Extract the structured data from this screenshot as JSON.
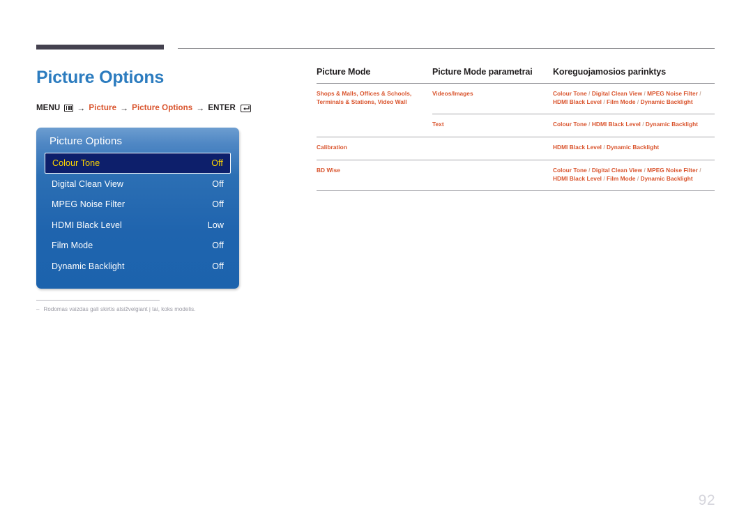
{
  "header": {
    "title": "Picture Options",
    "breadcrumb": {
      "menu_label": "MENU",
      "menu_icon": "menu-grid-icon",
      "arrow": "→",
      "step1": "Picture",
      "step2": "Picture Options",
      "enter_label": "ENTER",
      "enter_icon": "enter-return-icon"
    }
  },
  "osd": {
    "title": "Picture Options",
    "items": [
      {
        "label": "Colour Tone",
        "value": "Off",
        "selected": true
      },
      {
        "label": "Digital Clean View",
        "value": "Off",
        "selected": false
      },
      {
        "label": "MPEG Noise Filter",
        "value": "Off",
        "selected": false
      },
      {
        "label": "HDMI Black Level",
        "value": "Low",
        "selected": false
      },
      {
        "label": "Film Mode",
        "value": "Off",
        "selected": false
      },
      {
        "label": "Dynamic Backlight",
        "value": "Off",
        "selected": false
      }
    ]
  },
  "footnote": {
    "dash": "–",
    "text": "Rodomas vaizdas gali skirtis atsižvelgiant į tai, koks modelis."
  },
  "table": {
    "headers": [
      "Picture Mode",
      "Picture Mode parametrai",
      "Koreguojamosios parinktys"
    ],
    "rows": [
      {
        "mode": "Shops & Malls, Offices & Schools, Terminals & Stations, Video Wall",
        "parameter": "Videos/Images",
        "options": "Colour Tone / Digital Clean View / MPEG Noise Filter / HDMI Black Level / Film Mode / Dynamic Backlight",
        "rule": "partial"
      },
      {
        "mode": "",
        "parameter": "Text",
        "options": "Colour Tone / HDMI Black Level / Dynamic Backlight",
        "rule": "full"
      },
      {
        "mode": "Calibration",
        "parameter": "",
        "options": "HDMI Black Level / Dynamic Backlight",
        "rule": "full"
      },
      {
        "mode": "BD Wise",
        "parameter": "",
        "options": "Colour Tone / Digital Clean View / MPEG Noise Filter / HDMI Black Level / Film Mode / Dynamic Backlight",
        "rule": "full"
      }
    ]
  },
  "page_number": "92",
  "colors": {
    "title_blue": "#2c7cbf",
    "accent_orange": "#d9532c",
    "osd_blue": "#1f64ae",
    "osd_selected_bg": "#0d1f6b",
    "osd_selected_text": "#ffd600",
    "rule_dark": "#44414f"
  }
}
